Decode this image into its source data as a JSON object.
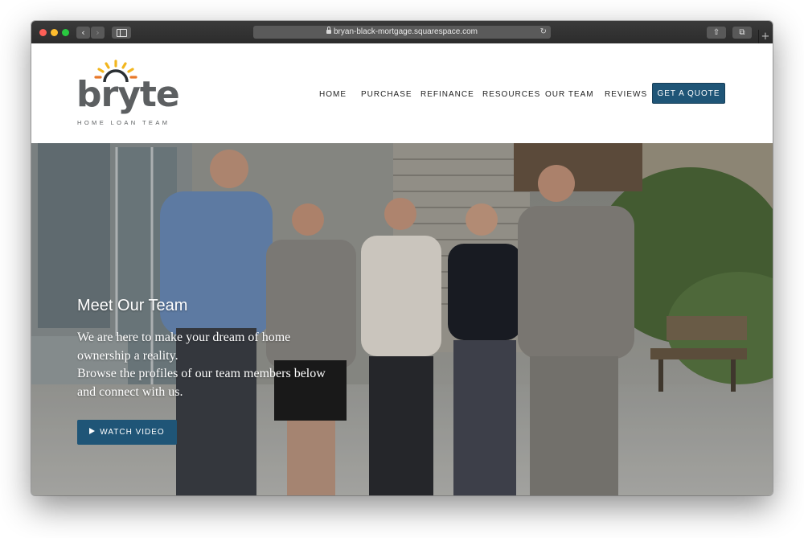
{
  "browser": {
    "url": "bryan-black-mortgage.squarespace.com",
    "back_glyph": "‹",
    "forward_glyph": "›",
    "reload_glyph": "↻",
    "share_glyph": "⇧",
    "tabs_glyph": "⧉",
    "new_tab_glyph": "+"
  },
  "logo": {
    "word": "bryte",
    "tagline": "HOME LOAN TEAM"
  },
  "nav": {
    "items": [
      "HOME",
      "PURCHASE",
      "REFINANCE",
      "RESOURCES",
      "OUR TEAM",
      "REVIEWS"
    ],
    "cta_label": "GET A QUOTE"
  },
  "hero": {
    "title": "Meet Our Team",
    "body_lines": [
      "We are here to make your dream of home",
      "ownership a reality.",
      "Browse the profiles of our team members below",
      "and connect with us."
    ],
    "video_button_label": "WATCH VIDEO"
  },
  "colors": {
    "brand_blue": "#1f5577",
    "logo_gray": "#5c5f61",
    "sun_yellow": "#f2b61e",
    "sun_orange": "#e8782a"
  }
}
